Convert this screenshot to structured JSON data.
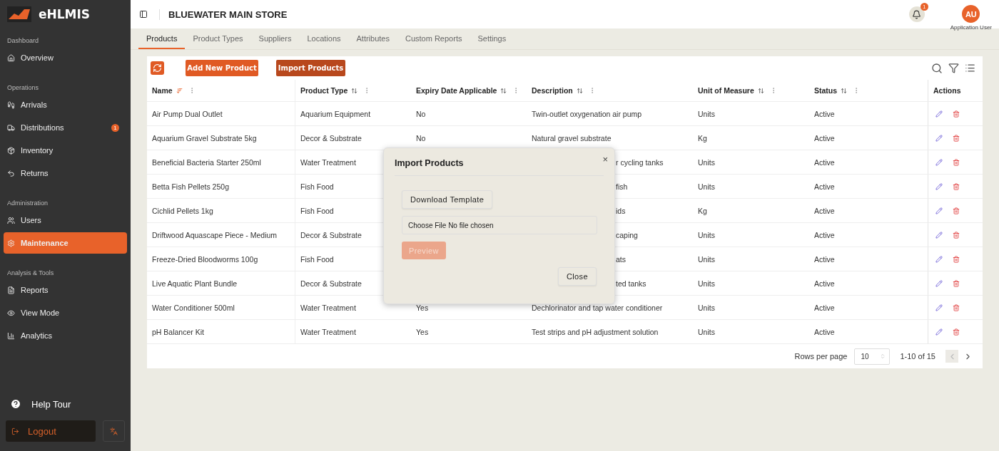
{
  "app": {
    "name": "eHLMIS"
  },
  "sidebar": {
    "sections": [
      {
        "title": "Dashboard",
        "items": [
          {
            "label": "Overview",
            "selected": false
          }
        ]
      },
      {
        "title": "Operations",
        "items": [
          {
            "label": "Arrivals",
            "selected": false
          },
          {
            "label": "Distributions",
            "selected": false,
            "badge": "1"
          },
          {
            "label": "Inventory",
            "selected": false
          },
          {
            "label": "Returns",
            "selected": false
          }
        ]
      },
      {
        "title": "Administration",
        "items": [
          {
            "label": "Users",
            "selected": false
          },
          {
            "label": "Maintenance",
            "selected": true
          }
        ]
      },
      {
        "title": "Analysis & Tools",
        "items": [
          {
            "label": "Reports",
            "selected": false
          },
          {
            "label": "View Mode",
            "selected": false
          },
          {
            "label": "Analytics",
            "selected": false
          }
        ]
      }
    ],
    "help": "Help Tour",
    "logout": "Logout"
  },
  "header": {
    "store": "BLUEWATER MAIN STORE",
    "notifications": "1",
    "avatar": "AU",
    "user": "Application User"
  },
  "tabs": [
    {
      "label": "Products",
      "selected": true
    },
    {
      "label": "Product Types",
      "selected": false
    },
    {
      "label": "Suppliers",
      "selected": false
    },
    {
      "label": "Locations",
      "selected": false
    },
    {
      "label": "Attributes",
      "selected": false
    },
    {
      "label": "Custom Reports",
      "selected": false
    },
    {
      "label": "Settings",
      "selected": false
    }
  ],
  "toolbar": {
    "buttons": [
      {
        "label": "Add New Product",
        "kind": "primary"
      },
      {
        "label": "Import Products",
        "kind": "dark"
      }
    ]
  },
  "table": {
    "columns": [
      {
        "label": "Name",
        "sorted": true
      },
      {
        "label": "Product Type",
        "sorted": false
      },
      {
        "label": "Expiry Date Applicable",
        "sorted": false
      },
      {
        "label": "Description",
        "sorted": false
      },
      {
        "label": "Unit of Measure",
        "sorted": false
      },
      {
        "label": "Status",
        "sorted": false
      },
      {
        "label": "Actions"
      }
    ],
    "rows": [
      {
        "name": "Air Pump Dual Outlet",
        "type": "Aquarium Equipment",
        "expiry": "No",
        "description": "Twin-outlet oxygenation air pump",
        "unit": "Units",
        "status": "Active"
      },
      {
        "name": "Aquarium Gravel Substrate 5kg",
        "type": "Decor & Substrate",
        "expiry": "No",
        "description": "Natural gravel substrate",
        "unit": "Kg",
        "status": "Active"
      },
      {
        "name": "Beneficial Bacteria Starter 250ml",
        "type": "Water Treatment",
        "description": "r cycling tanks",
        "unit": "Units",
        "status": "Active"
      },
      {
        "name": "Betta Fish Pellets 250g",
        "type": "Fish Food",
        "description": "fish",
        "unit": "Units",
        "status": "Active"
      },
      {
        "name": "Cichlid Pellets 1kg",
        "type": "Fish Food",
        "description": "ids",
        "unit": "Kg",
        "status": "Active"
      },
      {
        "name": "Driftwood Aquascape Piece - Medium",
        "type": "Decor & Substrate",
        "description": "caping",
        "unit": "Units",
        "status": "Active"
      },
      {
        "name": "Freeze-Dried Bloodworms 100g",
        "type": "Fish Food",
        "description": "ats",
        "unit": "Units",
        "status": "Active"
      },
      {
        "name": "Live Aquatic Plant Bundle",
        "type": "Decor & Substrate",
        "description": "ted tanks",
        "unit": "Units",
        "status": "Active"
      },
      {
        "name": "Water Conditioner 500ml",
        "type": "Water Treatment",
        "expiry": "Yes",
        "description": "Dechlorinator and tap water conditioner",
        "unit": "Units",
        "status": "Active"
      },
      {
        "name": "pH Balancer Kit",
        "type": "Water Treatment",
        "expiry": "Yes",
        "description": "Test strips and pH adjustment solution",
        "unit": "Units",
        "status": "Active"
      }
    ]
  },
  "pagination": {
    "label": "Rows per page",
    "rows": "10",
    "range": "1-10 of 15"
  },
  "modal": {
    "title": "Import Products",
    "close": "×",
    "download": "Download Template",
    "file": "Choose File No file chosen",
    "preview": {
      "label": "Preview",
      "disabled": true
    },
    "dismiss": "Close"
  }
}
